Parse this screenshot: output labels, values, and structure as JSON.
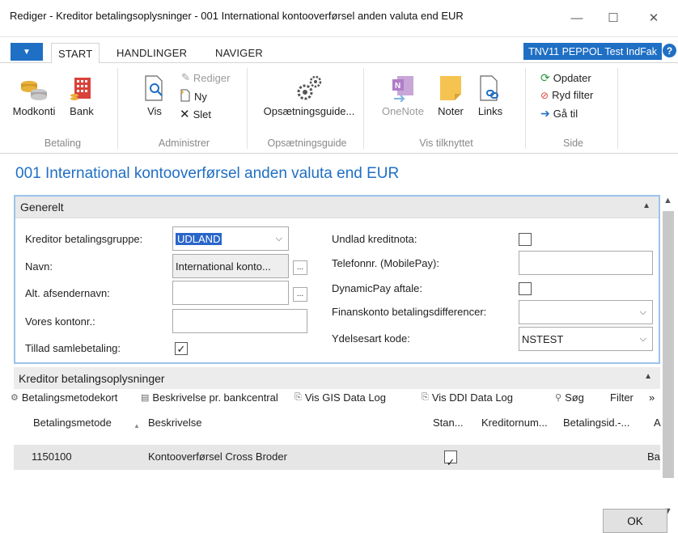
{
  "window": {
    "title": "Rediger - Kreditor betalingsoplysninger - 001 International kontooverførsel anden valuta end EUR",
    "minimize": "—",
    "maximize": "☐",
    "close": "✕"
  },
  "tabs": {
    "app_menu": "▼",
    "items": [
      "START",
      "HANDLINGER",
      "NAVIGER"
    ],
    "company": "TNV11 PEPPOL Test IndFak",
    "help": "?"
  },
  "ribbon": {
    "groups": [
      {
        "label": "Betaling",
        "buttons": [
          "Modkonti",
          "Bank"
        ]
      },
      {
        "label": "Administrer",
        "vis": "Vis",
        "rediger": "Rediger",
        "ny": "Ny",
        "slet": "Slet"
      },
      {
        "label": "Opsætningsguide",
        "buttons": [
          "Opsætningsguide..."
        ]
      },
      {
        "label": "Vis tilknyttet",
        "buttons": [
          "OneNote",
          "Noter",
          "Links"
        ]
      },
      {
        "label": "Side",
        "opdater": "Opdater",
        "ryd_filter": "Ryd filter",
        "gaa_til": "Gå til"
      }
    ]
  },
  "page_title": "001 International kontooverførsel anden valuta end EUR",
  "general": {
    "header": "Generelt",
    "left": {
      "kreditor_betalingsgruppe": {
        "label": "Kreditor betalingsgruppe:",
        "value": "UDLAND"
      },
      "navn": {
        "label": "Navn:",
        "value": "International konto..."
      },
      "alt_afsendernavn": {
        "label": "Alt. afsendernavn:",
        "value": ""
      },
      "vores_kontonr": {
        "label": "Vores kontonr.:",
        "value": ""
      },
      "tillad_samlebetaling": {
        "label": "Tillad samlebetaling:",
        "checked": true
      }
    },
    "right": {
      "undlad_kreditnota": {
        "label": "Undlad kreditnota:",
        "checked": false
      },
      "telefonnr": {
        "label": "Telefonnr. (MobilePay):",
        "value": ""
      },
      "dynamicpay": {
        "label": "DynamicPay aftale:",
        "checked": false
      },
      "finanskonto": {
        "label": "Finanskonto betalingsdifferencer:",
        "value": ""
      },
      "ydelsesart": {
        "label": "Ydelsesart kode:",
        "value": "NSTEST"
      }
    }
  },
  "subpage": {
    "header": "Kreditor betalingsoplysninger",
    "toolbar": [
      "Betalingsmetodekort",
      "Beskrivelse pr. bankcentral",
      "Vis GIS Data Log",
      "Vis DDI Data Log",
      "Søg",
      "Filter",
      "»"
    ],
    "columns": [
      "Betalingsmetode",
      "Beskrivelse",
      "Stan...",
      "Kreditornum...",
      "Betalingsid.-...",
      "A"
    ],
    "rows": [
      {
        "betalingsmetode": "1150100",
        "beskrivelse": "Kontooverførsel Cross Broder",
        "standard": true,
        "kreditornummer": "",
        "betalingsid": "",
        "a": "Ba"
      }
    ]
  },
  "ok_button": "OK",
  "colors": {
    "accent": "#1f6fc4",
    "focus_border": "#9cc3ea",
    "selection": "#2a66c9"
  }
}
